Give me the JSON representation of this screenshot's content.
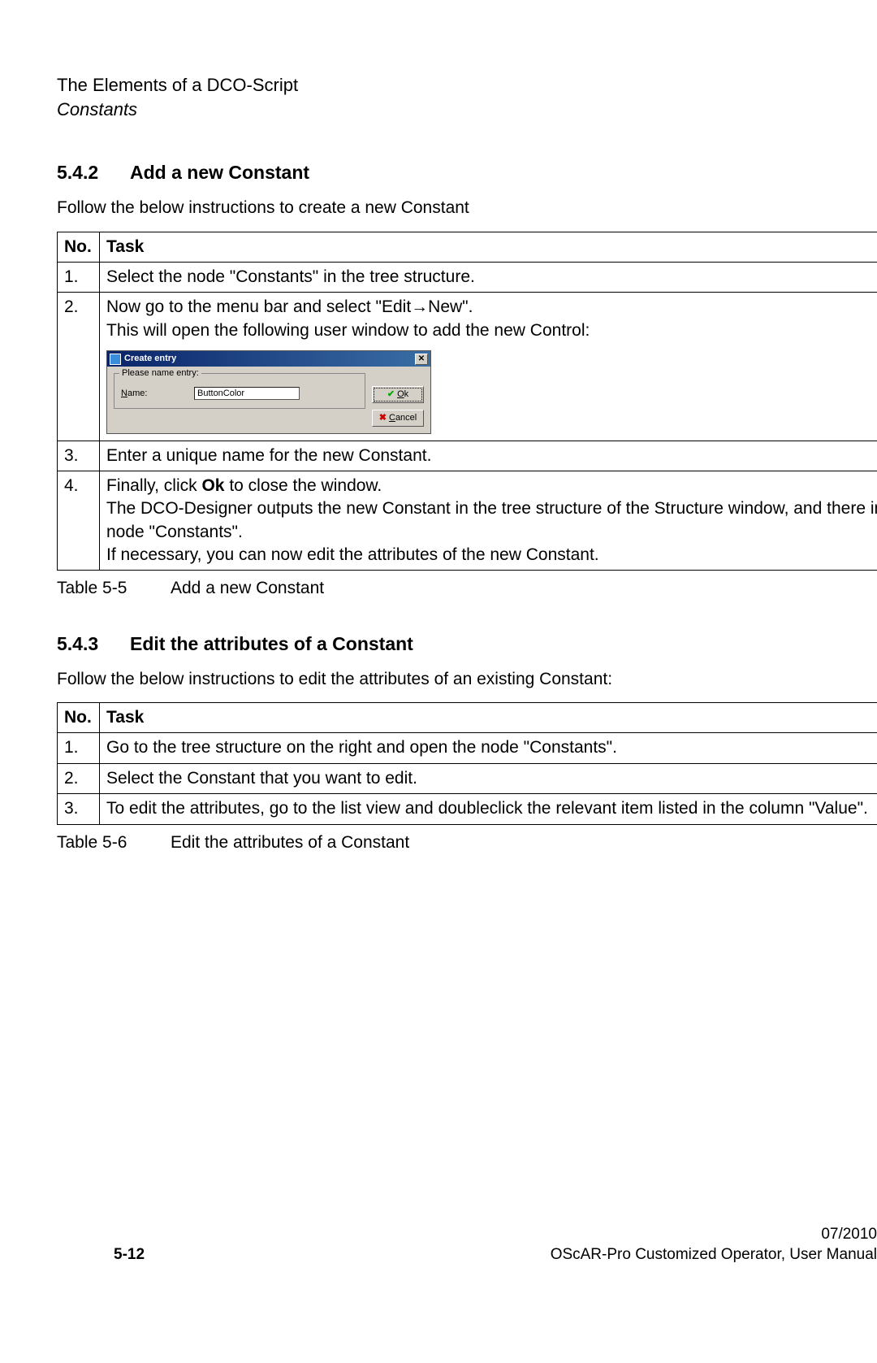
{
  "header": {
    "title": "The Elements of a DCO-Script",
    "subtitle": "Constants"
  },
  "section1": {
    "number": "5.4.2",
    "title": "Add a new Constant",
    "intro": "Follow the below instructions to create a new Constant",
    "table": {
      "head_no": "No.",
      "head_task": "Task",
      "rows": {
        "r1_no": "1.",
        "r1_task": "Select the node \"Constants\" in the tree structure.",
        "r2_no": "2.",
        "r2_line1_a": "Now go to the menu bar and select \"Edit",
        "r2_line1_b": "New\".",
        "r2_line2": "This will open the following user window to add the new Control:",
        "r3_no": "3.",
        "r3_task": "Enter a unique name for the new Constant.",
        "r4_no": "4.",
        "r4_a": "Finally, click ",
        "r4_b": "Ok",
        "r4_c": " to close the window.",
        "r4_d": "The DCO-Designer outputs the new Constant in the tree structure of the Structure window, and there in the node \"Constants\".",
        "r4_e": "If necessary, you can now edit the attributes of the new Constant."
      }
    },
    "caption_label": "Table 5-5",
    "caption_text": "Add a new Constant"
  },
  "dialog": {
    "title": "Create entry",
    "legend": "Please name entry:",
    "name_label_pre": "N",
    "name_label_post": "ame:",
    "name_value": "ButtonColor",
    "ok_pre": "O",
    "ok_post": "k",
    "cancel_pre": "C",
    "cancel_post": "ancel"
  },
  "section2": {
    "number": "5.4.3",
    "title": "Edit the attributes of a Constant",
    "intro": "Follow the below instructions to edit the attributes of an existing Constant:",
    "table": {
      "head_no": "No.",
      "head_task": "Task",
      "rows": {
        "r1_no": "1.",
        "r1_task": "Go to the tree structure on the right and open the node \"Constants\".",
        "r2_no": "2.",
        "r2_task": "Select the Constant that you want to edit.",
        "r3_no": "3.",
        "r3_task": "To edit the attributes, go to the list view and doubleclick the relevant item listed in the column \"Value\"."
      }
    },
    "caption_label": "Table 5-6",
    "caption_text": "Edit the attributes of a Constant"
  },
  "footer": {
    "page": "5-12",
    "date": "07/2010",
    "doc": "OScAR-Pro Customized Operator, User Manual"
  }
}
